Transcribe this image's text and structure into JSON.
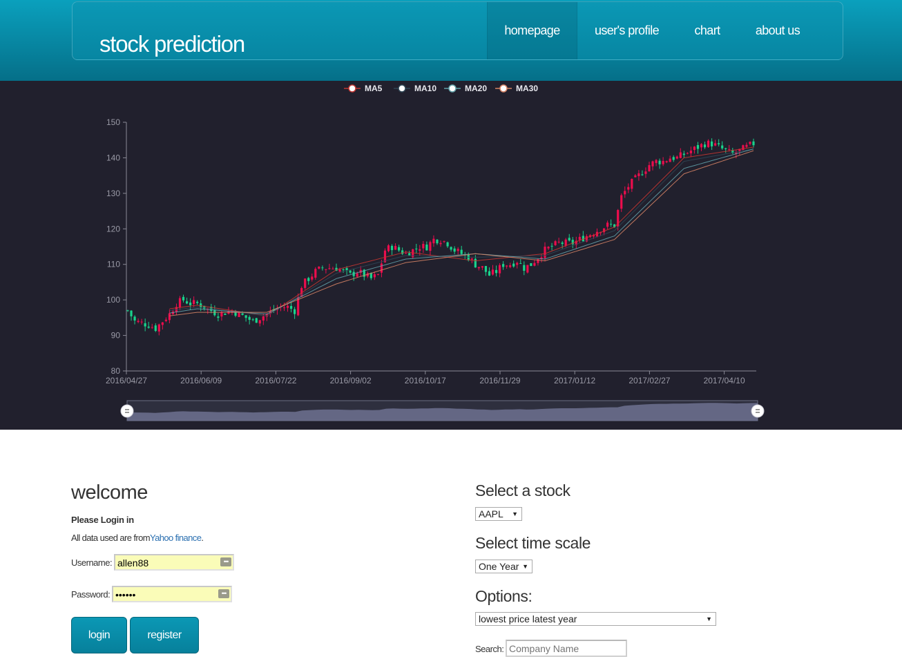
{
  "header": {
    "brand": "stock prediction",
    "nav": [
      "homepage",
      "user's profile",
      "chart",
      "about us"
    ],
    "active": "homepage"
  },
  "legend": [
    {
      "name": "MA5",
      "color": "#c23531"
    },
    {
      "name": "MA10",
      "color": "#2f4554"
    },
    {
      "name": "MA20",
      "color": "#61a0a8"
    },
    {
      "name": "MA30",
      "color": "#d48265"
    }
  ],
  "colors": {
    "up": "#ec0d4d",
    "down": "#19d38c",
    "panel_bg": "#21202d",
    "brand": "#0786a2"
  },
  "chart_data": {
    "type": "candlestick",
    "title": "",
    "ylim": [
      80,
      150
    ],
    "y_ticks": [
      "80",
      "90",
      "100",
      "110",
      "120",
      "130",
      "140",
      "150"
    ],
    "x_ticks": [
      "2016/04/27",
      "2016/06/09",
      "2016/07/22",
      "2016/09/02",
      "2016/10/17",
      "2016/11/29",
      "2017/01/12",
      "2017/02/27",
      "2017/04/10"
    ],
    "close_series": [
      [
        0,
        97
      ],
      [
        2,
        94
      ],
      [
        4,
        93.5
      ],
      [
        6,
        93
      ],
      [
        8,
        92
      ],
      [
        10,
        94
      ],
      [
        12,
        96
      ],
      [
        14,
        99
      ],
      [
        16,
        100
      ],
      [
        18,
        99
      ],
      [
        20,
        99
      ],
      [
        22,
        98
      ],
      [
        24,
        97
      ],
      [
        26,
        96
      ],
      [
        28,
        96.5
      ],
      [
        30,
        97
      ],
      [
        32,
        96
      ],
      [
        34,
        95
      ],
      [
        36,
        94
      ],
      [
        38,
        95
      ],
      [
        40,
        96
      ],
      [
        42,
        97
      ],
      [
        44,
        98
      ],
      [
        46,
        98
      ],
      [
        48,
        97
      ],
      [
        50,
        104
      ],
      [
        52,
        106
      ],
      [
        54,
        108
      ],
      [
        56,
        109
      ],
      [
        58,
        109
      ],
      [
        60,
        109
      ],
      [
        62,
        108
      ],
      [
        64,
        107
      ],
      [
        66,
        108
      ],
      [
        68,
        107
      ],
      [
        70,
        106
      ],
      [
        72,
        107
      ],
      [
        74,
        114
      ],
      [
        76,
        115
      ],
      [
        78,
        114
      ],
      [
        80,
        113
      ],
      [
        82,
        114
      ],
      [
        84,
        115
      ],
      [
        86,
        115
      ],
      [
        88,
        117
      ],
      [
        90,
        117
      ],
      [
        92,
        116
      ],
      [
        94,
        114
      ],
      [
        96,
        113
      ],
      [
        98,
        112
      ],
      [
        100,
        110
      ],
      [
        102,
        109
      ],
      [
        104,
        107
      ],
      [
        106,
        108
      ],
      [
        108,
        110
      ],
      [
        110,
        110
      ],
      [
        112,
        111
      ],
      [
        114,
        109
      ],
      [
        116,
        110
      ],
      [
        118,
        112
      ],
      [
        120,
        114
      ],
      [
        122,
        115
      ],
      [
        124,
        116
      ],
      [
        126,
        116
      ],
      [
        128,
        116
      ],
      [
        130,
        117
      ],
      [
        132,
        118
      ],
      [
        134,
        119
      ],
      [
        136,
        120
      ],
      [
        138,
        121
      ],
      [
        140,
        121
      ],
      [
        142,
        129
      ],
      [
        144,
        132
      ],
      [
        146,
        134
      ],
      [
        148,
        136
      ],
      [
        150,
        138
      ],
      [
        152,
        139
      ],
      [
        154,
        139
      ],
      [
        156,
        140
      ],
      [
        158,
        140
      ],
      [
        160,
        141
      ],
      [
        162,
        142
      ],
      [
        164,
        143
      ],
      [
        166,
        144
      ],
      [
        168,
        144
      ],
      [
        170,
        143
      ],
      [
        172,
        142
      ],
      [
        174,
        141
      ],
      [
        176,
        142
      ],
      [
        178,
        143
      ],
      [
        180,
        144
      ]
    ],
    "ma_series": [
      {
        "name": "MA5",
        "points": [
          [
            0,
            96
          ],
          [
            20,
            98.5
          ],
          [
            40,
            95.5
          ],
          [
            60,
            108.5
          ],
          [
            80,
            113.5
          ],
          [
            100,
            111
          ],
          [
            120,
            113
          ],
          [
            140,
            120.5
          ],
          [
            160,
            140
          ],
          [
            180,
            143
          ]
        ]
      },
      {
        "name": "MA10",
        "points": [
          [
            0,
            95.5
          ],
          [
            20,
            98
          ],
          [
            40,
            95.5
          ],
          [
            60,
            107.5
          ],
          [
            80,
            112.5
          ],
          [
            100,
            112
          ],
          [
            120,
            112.5
          ],
          [
            140,
            119.5
          ],
          [
            160,
            139
          ],
          [
            180,
            142.5
          ]
        ]
      },
      {
        "name": "MA20",
        "points": [
          [
            0,
            94.5
          ],
          [
            20,
            97.5
          ],
          [
            40,
            96
          ],
          [
            60,
            106
          ],
          [
            80,
            111.5
          ],
          [
            100,
            113
          ],
          [
            120,
            111.5
          ],
          [
            140,
            118
          ],
          [
            160,
            137
          ],
          [
            180,
            142.5
          ]
        ]
      },
      {
        "name": "MA30",
        "points": [
          [
            0,
            94
          ],
          [
            20,
            96.5
          ],
          [
            40,
            96.5
          ],
          [
            60,
            104.5
          ],
          [
            80,
            110.5
          ],
          [
            100,
            113
          ],
          [
            120,
            111
          ],
          [
            140,
            117
          ],
          [
            160,
            135.5
          ],
          [
            180,
            142
          ]
        ]
      }
    ]
  },
  "login": {
    "heading": "welcome",
    "subheading": "Please Login in",
    "data_from_prefix": "All data used are from",
    "data_from_link": "Yahoo finance",
    "data_from_suffix": ".",
    "username_label": "Username:",
    "username_value": "allen88",
    "password_label": "Password:",
    "password_value": "••••••",
    "login_button": "login",
    "register_button": "register"
  },
  "options": {
    "select_stock_heading": "Select a stock",
    "stock_value": "AAPL",
    "select_time_heading": "Select time scale",
    "time_value": "One Year",
    "options_heading": "Options:",
    "option_value": "lowest price latest year",
    "search_label": "Search:",
    "search_placeholder": "Company Name"
  }
}
